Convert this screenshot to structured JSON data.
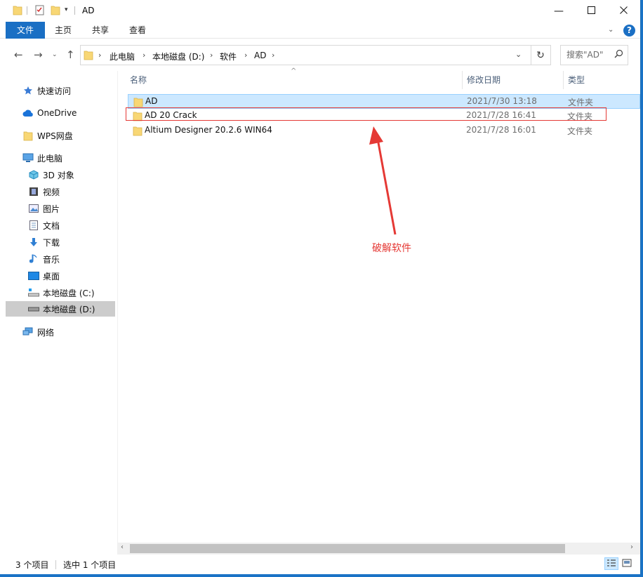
{
  "window": {
    "title": "AD",
    "accent": "#1a6fc4"
  },
  "ribbon": {
    "tabs": [
      "文件",
      "主页",
      "共享",
      "查看"
    ]
  },
  "address": {
    "crumbs": [
      "此电脑",
      "本地磁盘 (D:)",
      "软件",
      "AD"
    ],
    "search_placeholder": "搜索\"AD\""
  },
  "sidebar": {
    "items": [
      {
        "label": "快速访问",
        "icon": "star-icon"
      },
      {
        "label": "OneDrive",
        "icon": "cloud-icon"
      },
      {
        "label": "WPS网盘",
        "icon": "folder-icon"
      },
      {
        "label": "此电脑",
        "icon": "computer-icon"
      },
      {
        "label": "3D 对象",
        "icon": "cube-icon"
      },
      {
        "label": "视频",
        "icon": "film-icon"
      },
      {
        "label": "图片",
        "icon": "picture-icon"
      },
      {
        "label": "文档",
        "icon": "document-icon"
      },
      {
        "label": "下载",
        "icon": "download-icon"
      },
      {
        "label": "音乐",
        "icon": "music-icon"
      },
      {
        "label": "桌面",
        "icon": "desktop-icon"
      },
      {
        "label": "本地磁盘 (C:)",
        "icon": "drive-icon"
      },
      {
        "label": "本地磁盘 (D:)",
        "icon": "drive-icon",
        "selected": true
      },
      {
        "label": "网络",
        "icon": "network-icon"
      }
    ]
  },
  "columns": {
    "name": "名称",
    "date": "修改日期",
    "type": "类型"
  },
  "files": [
    {
      "name": "AD",
      "date": "2021/7/30 13:18",
      "type": "文件夹",
      "selected": true
    },
    {
      "name": "AD 20 Crack",
      "date": "2021/7/28 16:41",
      "type": "文件夹"
    },
    {
      "name": "Altium Designer 20.2.6 WIN64",
      "date": "2021/7/28 16:01",
      "type": "文件夹"
    }
  ],
  "annotation": {
    "label": "破解软件",
    "color": "#e53935"
  },
  "status": {
    "count": "3 个项目",
    "selected": "选中 1 个项目"
  }
}
